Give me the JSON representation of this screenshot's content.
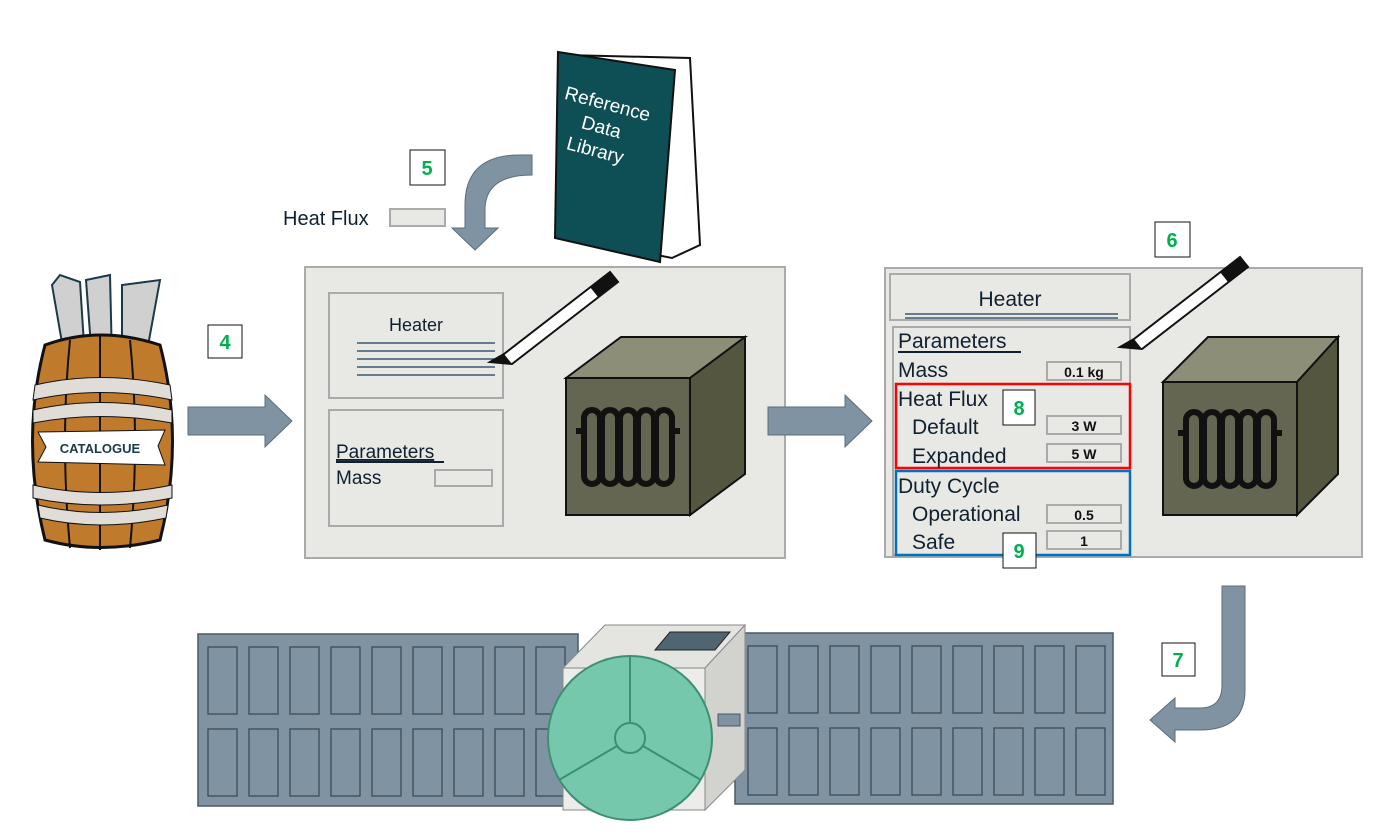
{
  "book": {
    "title_lines": [
      "Reference",
      "Data",
      "Library"
    ],
    "color": "#0d4f55"
  },
  "barrel": {
    "label": "CATALOGUE",
    "color": "#c07a2c"
  },
  "step_labels": {
    "s4": "4",
    "s5": "5",
    "s6": "6",
    "s7": "7",
    "s8": "8",
    "s9": "9",
    "color": "#00b050"
  },
  "floating_field": {
    "label": "Heat Flux",
    "value": ""
  },
  "panel_before": {
    "title": "Heater",
    "parameters_heading": "Parameters",
    "mass_label": "Mass",
    "mass_value": ""
  },
  "panel_after": {
    "title": "Heater",
    "parameters_heading": "Parameters",
    "mass_label": "Mass",
    "mass_value": "0.1 kg",
    "heat_flux": {
      "label": "Heat Flux",
      "default_label": "Default",
      "default_value": "3 W",
      "expanded_label": "Expanded",
      "expanded_value": "5 W",
      "highlight_color": "#ff0000"
    },
    "duty_cycle": {
      "label": "Duty Cycle",
      "operational_label": "Operational",
      "operational_value": "0.5",
      "safe_label": "Safe",
      "safe_value": "1",
      "highlight_color": "#0070c0"
    }
  },
  "colors": {
    "panel_bg": "#e8e8e4",
    "arrow": "#7f93a3",
    "cube": "#646652",
    "satellite_panel": "#7f93a3",
    "dish": "#76c8ad"
  }
}
